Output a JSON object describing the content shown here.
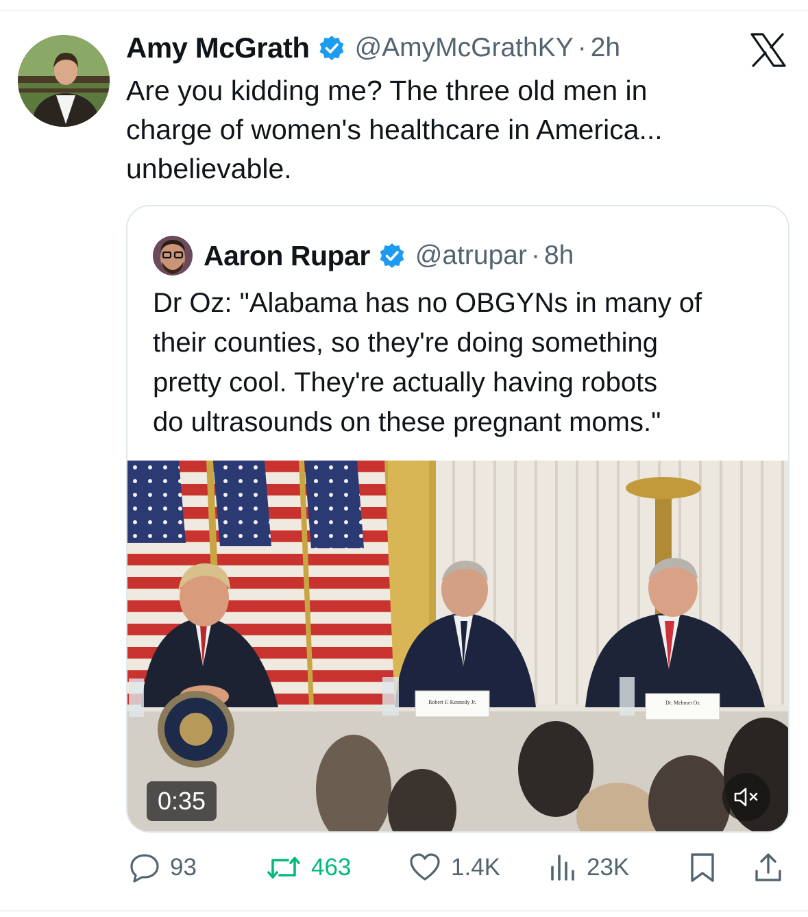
{
  "tweet": {
    "author_name": "Amy McGrath",
    "handle": "@AmyMcGrathKY",
    "separator": "·",
    "time": "2h",
    "text_lines": [
      "Are you kidding me? The three old men in",
      "charge of women's healthcare in America...",
      "unbelievable."
    ]
  },
  "quoted_tweet": {
    "author_name": "Aaron Rupar",
    "handle": "@atrupar",
    "separator": "·",
    "time": "8h",
    "text_lines": [
      "Dr Oz: \"Alabama has no OBGYNs in many of",
      "their counties, so they're doing something",
      "pretty cool. They're actually having robots",
      "do ultrasounds on these pregnant moms.\""
    ],
    "video": {
      "duration": "0:35",
      "muted": true,
      "nameplates": [
        "Robert F. Kennedy Jr.",
        "Dr. Mehmet Oz"
      ]
    }
  },
  "actions": {
    "replies": "93",
    "reposts": "463",
    "likes": "1.4K",
    "views": "23K"
  },
  "icons": {
    "verified": "verified-badge-icon",
    "platform": "x-logo-icon",
    "reply": "reply-icon",
    "repost": "repost-icon",
    "like": "heart-icon",
    "views": "views-icon",
    "bookmark": "bookmark-icon",
    "share": "share-icon",
    "mute": "muted-speaker-icon"
  },
  "colors": {
    "verified": "#1d9bf0",
    "repost": "#00ba7c",
    "secondary_text": "#536471",
    "text": "#0f1419"
  }
}
